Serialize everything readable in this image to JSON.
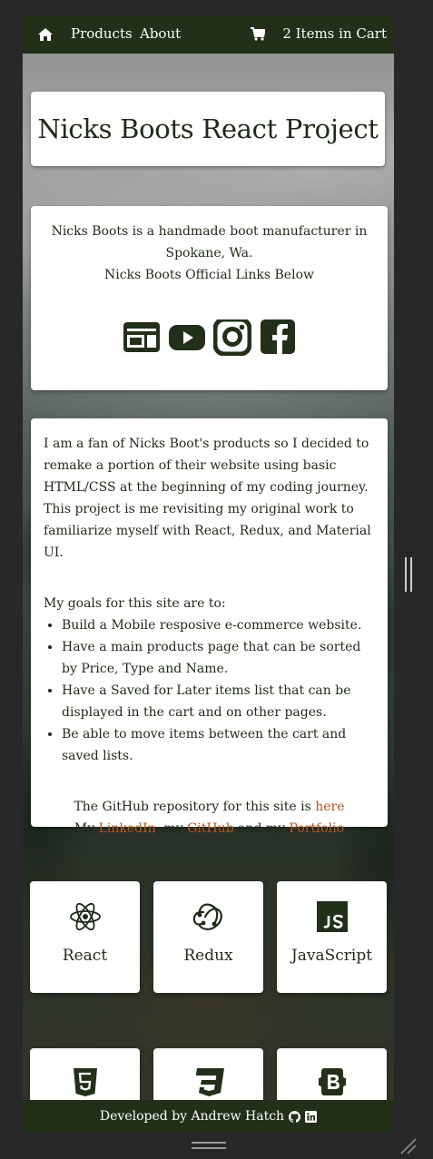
{
  "nav": {
    "products": "Products",
    "about": "About",
    "cart": "2 Items in Cart"
  },
  "title": "Nicks Boots React Project",
  "about": {
    "line1": "Nicks Boots is a handmade boot manufacturer in Spokane, Wa.",
    "line2": "Nicks Boots Official Links Below",
    "socials": [
      "website-icon",
      "youtube-icon",
      "instagram-icon",
      "facebook-icon"
    ]
  },
  "info": {
    "p1": "I am a fan of Nicks Boot's products so I decided to remake a portion of their website using basic HTML/CSS at the beginning of my coding journey.",
    "p2": "This project is me revisiting my original work to familiarize myself with React, Redux, and Material UI.",
    "goals_heading": "My goals for this site are to:",
    "goals": [
      "Build a Mobile resposive e-commerce website.",
      "Have a main products page that can be sorted by Price, Type and Name.",
      "Have a Saved for Later items list that can be displayed in the cart and on other pages.",
      "Be able to move items between the cart and saved lists."
    ],
    "repo_text": "The GitHub repository for this site is ",
    "repo_link": "here",
    "links_prefix": "My ",
    "linkedin": "LinkedIn",
    "sep1": ", my ",
    "github": "GitHub",
    "sep2": " and my ",
    "portfolio": "Portfolio"
  },
  "tech": [
    {
      "label": "React",
      "icon": "react-icon"
    },
    {
      "label": "Redux",
      "icon": "redux-icon"
    },
    {
      "label": "JavaScript",
      "icon": "javascript-icon"
    },
    {
      "label": "",
      "icon": "html5-icon"
    },
    {
      "label": "",
      "icon": "css3-icon"
    },
    {
      "label": "",
      "icon": "bootstrap-icon"
    }
  ],
  "footer": {
    "text": "Developed by Andrew Hatch"
  },
  "colors": {
    "nav_bg": "#223019",
    "text_dark": "#1f2a18",
    "link": "#b3541e"
  }
}
